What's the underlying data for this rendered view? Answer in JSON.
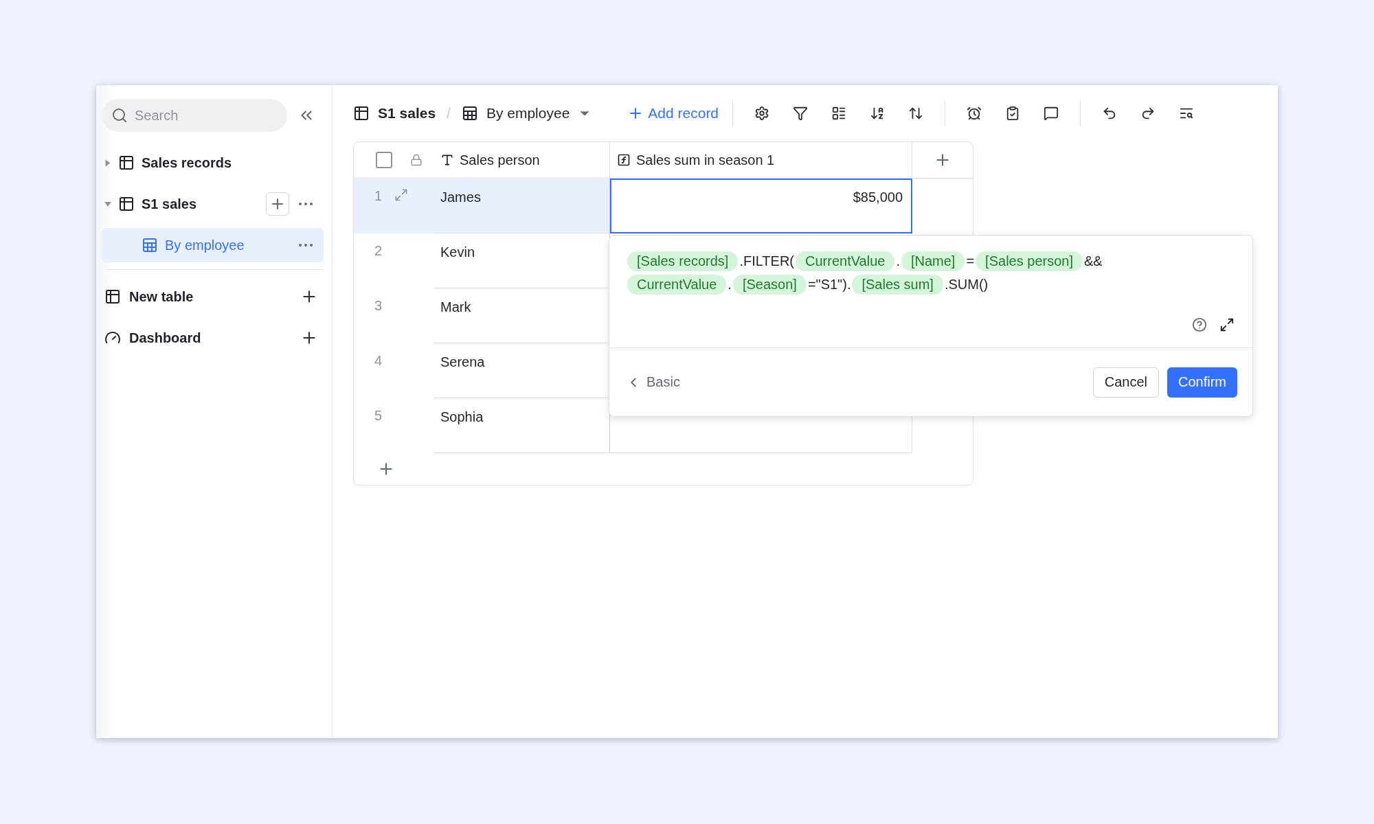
{
  "sidebar": {
    "search": {
      "placeholder": "Search"
    },
    "tree": [
      {
        "label": "Sales records",
        "expanded": false,
        "selected": false,
        "hovered": false
      },
      {
        "label": "S1 sales",
        "expanded": true,
        "selected": false,
        "hovered": true,
        "children": [
          {
            "label": "By employee",
            "selected": true
          }
        ]
      }
    ],
    "sections": [
      {
        "label": "New table",
        "kind": "table"
      },
      {
        "label": "Dashboard",
        "kind": "dashboard"
      }
    ]
  },
  "toolbar": {
    "table": "S1 sales",
    "separator": "/",
    "view": "By employee",
    "add_record": "Add record"
  },
  "table": {
    "select_all": {
      "checked": false
    },
    "columns": [
      {
        "label": "Sales person",
        "kind": "text"
      },
      {
        "label": "Sales sum in season 1",
        "kind": "formula"
      }
    ],
    "rows": [
      {
        "number": "1",
        "name": "James",
        "value": "$85,000",
        "selected": true
      },
      {
        "number": "2",
        "name": "Kevin",
        "selected": false
      },
      {
        "number": "3",
        "name": "Mark",
        "selected": false
      },
      {
        "number": "4",
        "name": "Serena",
        "selected": false
      },
      {
        "number": "5",
        "name": "Sophia",
        "selected": false
      }
    ]
  },
  "formula_editor": {
    "lines": [
      [
        {
          "kind": "field",
          "text": "[Sales records]"
        },
        {
          "kind": "code",
          "text": ".FILTER("
        },
        {
          "kind": "field",
          "text": "CurrentValue"
        },
        {
          "kind": "code",
          "text": "."
        },
        {
          "kind": "field",
          "text": "[Name]"
        },
        {
          "kind": "code",
          "text": "="
        },
        {
          "kind": "field",
          "text": "[Sales person]"
        },
        {
          "kind": "code",
          "text": "&&"
        }
      ],
      [
        {
          "kind": "field",
          "text": "CurrentValue"
        },
        {
          "kind": "code",
          "text": "."
        },
        {
          "kind": "field",
          "text": "[Season]"
        },
        {
          "kind": "code",
          "text": "=\"S1\")."
        },
        {
          "kind": "field",
          "text": "[Sales sum]"
        },
        {
          "kind": "code",
          "text": ".SUM()"
        }
      ]
    ],
    "back": "Basic",
    "cancel": "Cancel",
    "confirm": "Confirm"
  }
}
